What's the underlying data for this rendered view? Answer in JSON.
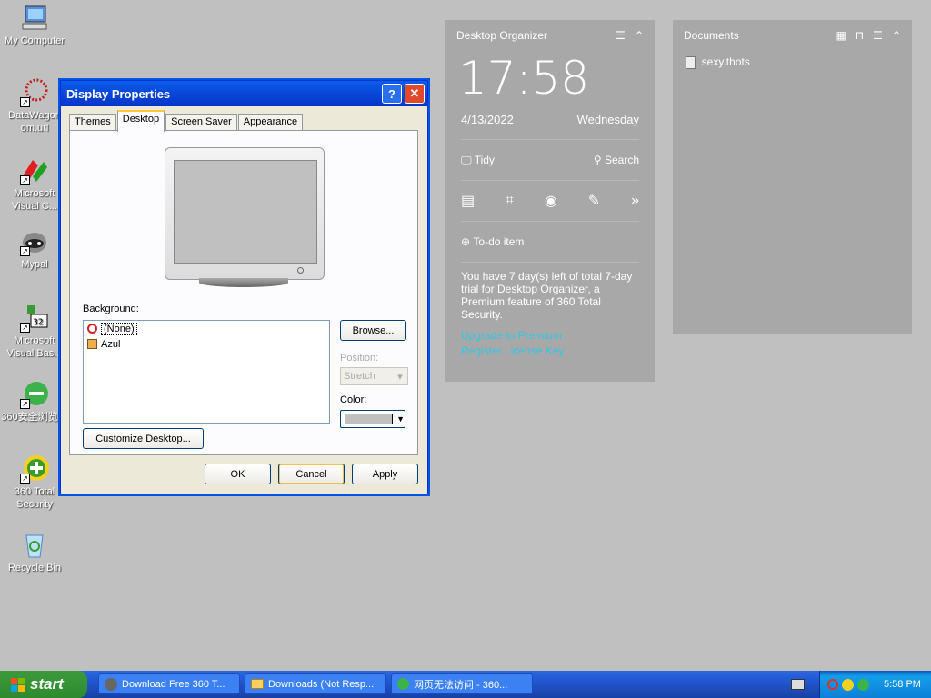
{
  "desktop_icons": [
    {
      "label": "My Computer",
      "icon": "computer-icon"
    },
    {
      "label": "DataWagon om.url",
      "icon": "shortcut-icon"
    },
    {
      "label": "Microsoft Visual C...",
      "icon": "visual-c-icon"
    },
    {
      "label": "Mypal",
      "icon": "raccoon-icon"
    },
    {
      "label": "Microsoft Visual Bas...",
      "icon": "visual-basic-icon"
    },
    {
      "label": "360安全浏览器",
      "icon": "browser-icon"
    },
    {
      "label": "360 Total Security",
      "icon": "shield-plus-icon"
    },
    {
      "label": "Recycle Bin",
      "icon": "recycle-bin-icon"
    }
  ],
  "organizer": {
    "title": "Desktop Organizer",
    "time": "17:58",
    "date": "4/13/2022",
    "weekday": "Wednesday",
    "tidy": "Tidy",
    "search": "Search",
    "todo": "To-do item",
    "trial": "You have 7 day(s) left of total 7-day trial for Desktop Organizer, a Premium feature of 360 Total Security.",
    "link1": "Upgrade to Premium",
    "link2": "Register License Key"
  },
  "documents": {
    "title": "Documents",
    "file": "sexy.thots"
  },
  "dialog": {
    "title": "Display Properties",
    "tabs": [
      "Themes",
      "Desktop",
      "Screen Saver",
      "Appearance"
    ],
    "background_label": "Background:",
    "backgrounds": [
      "(None)",
      "Azul"
    ],
    "browse": "Browse...",
    "position_label": "Position:",
    "position_value": "Stretch",
    "color_label": "Color:",
    "color_value": "#c0c0c0",
    "customize": "Customize Desktop...",
    "ok": "OK",
    "cancel": "Cancel",
    "apply": "Apply"
  },
  "taskbar": {
    "start": "start",
    "tasks": [
      "Download Free 360 T...",
      "Downloads (Not Resp...",
      "网页无法访问 - 360..."
    ],
    "clock": "5:58 PM"
  }
}
